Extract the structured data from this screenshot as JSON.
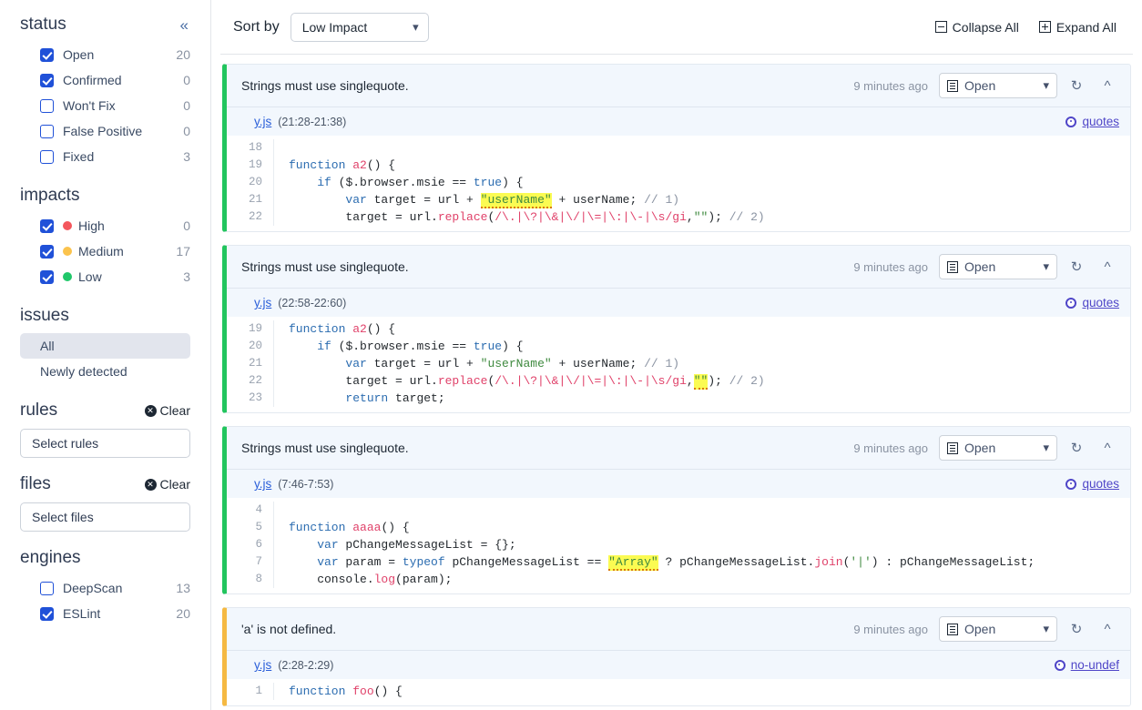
{
  "sidebar": {
    "collapse_icon": "chevrons-left-icon",
    "status": {
      "title": "status",
      "items": [
        {
          "label": "Open",
          "count": "20",
          "checked": true
        },
        {
          "label": "Confirmed",
          "count": "0",
          "checked": true
        },
        {
          "label": "Won't Fix",
          "count": "0",
          "checked": false
        },
        {
          "label": "False Positive",
          "count": "0",
          "checked": false
        },
        {
          "label": "Fixed",
          "count": "3",
          "checked": false
        }
      ]
    },
    "impacts": {
      "title": "impacts",
      "items": [
        {
          "label": "High",
          "count": "0",
          "checked": true,
          "color": "#f4565c"
        },
        {
          "label": "Medium",
          "count": "17",
          "checked": true,
          "color": "#fbc34d"
        },
        {
          "label": "Low",
          "count": "3",
          "checked": true,
          "color": "#20c76a"
        }
      ]
    },
    "issues": {
      "title": "issues",
      "items": [
        {
          "label": "All",
          "active": true
        },
        {
          "label": "Newly detected",
          "active": false
        }
      ]
    },
    "rules": {
      "title": "rules",
      "clear_label": "Clear",
      "select_placeholder": "Select rules"
    },
    "files": {
      "title": "files",
      "clear_label": "Clear",
      "select_placeholder": "Select files"
    },
    "engines": {
      "title": "engines",
      "items": [
        {
          "label": "DeepScan",
          "count": "13",
          "checked": false
        },
        {
          "label": "ESLint",
          "count": "20",
          "checked": true
        }
      ]
    }
  },
  "toolbar": {
    "sort_label": "Sort by",
    "sort_value": "Low Impact",
    "collapse_all": "Collapse All",
    "expand_all": "Expand All"
  },
  "cards": [
    {
      "title": "Strings must use singlequote.",
      "ago": "9 minutes ago",
      "status": "Open",
      "file": "y.js",
      "range": "(21:28-21:38)",
      "rule": "quotes",
      "impact": "low",
      "lines": [
        {
          "no": "18",
          "text": ""
        },
        {
          "no": "19",
          "text": "function a2() {"
        },
        {
          "no": "20",
          "text": "    if ($.browser.msie == true) {"
        },
        {
          "no": "21",
          "text": "        var target = url + \"userName\" + userName; // 1)"
        },
        {
          "no": "22",
          "text": "        target = url.replace(/\\.|\\?|\\&|\\/|\\=|\\:|\\-|\\s/gi,\"\"); // 2)"
        }
      ]
    },
    {
      "title": "Strings must use singlequote.",
      "ago": "9 minutes ago",
      "status": "Open",
      "file": "y.js",
      "range": "(22:58-22:60)",
      "rule": "quotes",
      "impact": "low",
      "lines": [
        {
          "no": "19",
          "text": "function a2() {"
        },
        {
          "no": "20",
          "text": "    if ($.browser.msie == true) {"
        },
        {
          "no": "21",
          "text": "        var target = url + \"userName\" + userName; // 1)"
        },
        {
          "no": "22",
          "text": "        target = url.replace(/\\.|\\?|\\&|\\/|\\=|\\:|\\-|\\s/gi,\"\"); // 2)"
        },
        {
          "no": "23",
          "text": "        return target;"
        }
      ]
    },
    {
      "title": "Strings must use singlequote.",
      "ago": "9 minutes ago",
      "status": "Open",
      "file": "y.js",
      "range": "(7:46-7:53)",
      "rule": "quotes",
      "impact": "low",
      "lines": [
        {
          "no": "4",
          "text": ""
        },
        {
          "no": "5",
          "text": "function aaaa() {"
        },
        {
          "no": "6",
          "text": "    var pChangeMessageList = {};"
        },
        {
          "no": "7",
          "text": "    var param = typeof pChangeMessageList == \"Array\" ? pChangeMessageList.join('|') : pChangeMessageList;"
        },
        {
          "no": "8",
          "text": "    console.log(param);"
        }
      ]
    },
    {
      "title": "'a' is not defined.",
      "ago": "9 minutes ago",
      "status": "Open",
      "file": "y.js",
      "range": "(2:28-2:29)",
      "rule": "no-undef",
      "impact": "medium",
      "lines": [
        {
          "no": "1",
          "text": "function foo() {"
        }
      ]
    }
  ],
  "icons": {
    "status_list": "list-icon",
    "revert": "revert-icon",
    "collapse_card": "chevron-up-icon",
    "dropdown": "chevron-down-icon",
    "rule_badge": "ring-icon",
    "collapse_all": "minus-box-icon",
    "expand_all": "plus-box-icon",
    "clear": "clear-circle-icon"
  },
  "colors": {
    "accent": "#2051d8",
    "low": "#22c55e",
    "medium": "#f5b942",
    "high": "#f4565c",
    "card_bg": "#f2f7fd",
    "rule_link": "#4f46c8",
    "file_link": "#2b5fd9",
    "highlight": "#fbfb52"
  }
}
